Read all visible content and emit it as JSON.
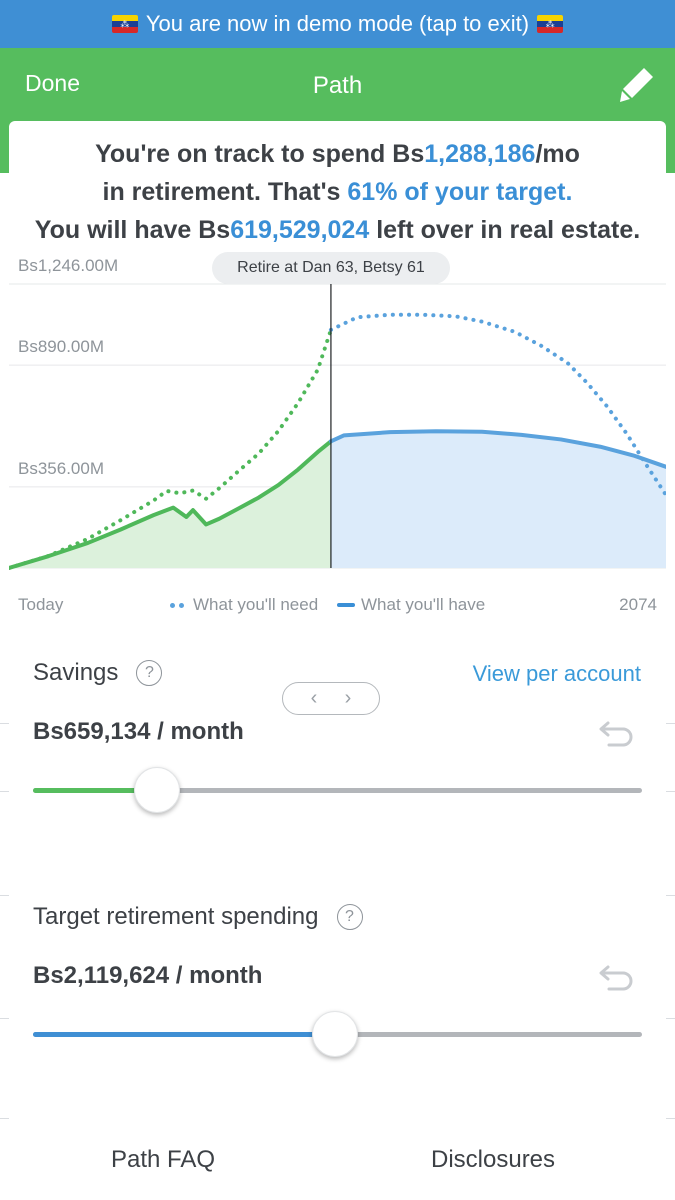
{
  "banner": {
    "text": "You are now in demo mode (tap to exit)"
  },
  "header": {
    "done_label": "Done",
    "title": "Path",
    "edit_icon": "pencil-icon"
  },
  "summary": {
    "line1_prefix": "You're on track to spend Bs",
    "line1_amount": "1,288,186",
    "line1_suffix": "/mo",
    "line2_prefix": "in retirement. That's ",
    "line2_pct": "61% of your target.",
    "line3_prefix": "You will have Bs",
    "line3_amount": "619,529,024",
    "line3_suffix": " left over in real estate."
  },
  "chart": {
    "retire_label": "Retire at Dan 63, Betsy 61",
    "start_label": "Today",
    "end_label": "2074",
    "legend_need": "What you'll need",
    "legend_have": "What you'll have",
    "colors": {
      "have_pre": "#4fb85a",
      "have_pre_fill": "#dcf1dc",
      "have_post": "#5aa2dd",
      "have_post_fill": "#dcebfa",
      "need": "#5aa2dd"
    }
  },
  "chart_data": {
    "type": "area",
    "y_tick_labels": [
      "Bs1,246.00M",
      "Bs890.00M",
      "Bs356.00M"
    ],
    "y_ticks": [
      1246,
      890,
      356
    ],
    "ylim": [
      0,
      1246
    ],
    "xlim": [
      0,
      100
    ],
    "retire_x": 49,
    "series": [
      {
        "name": "What you'll need",
        "style": "dotted",
        "x": [
          0,
          6,
          12,
          17,
          22,
          24,
          26,
          28,
          30,
          32,
          35,
          38,
          41,
          44,
          47,
          49,
          53,
          58,
          63,
          68,
          72,
          77,
          81,
          85,
          88,
          91,
          94,
          97,
          100
        ],
        "y": [
          0,
          53,
          128,
          210,
          296,
          338,
          328,
          340,
          304,
          350,
          427,
          502,
          601,
          724,
          870,
          1045,
          1100,
          1111,
          1111,
          1104,
          1081,
          1036,
          975,
          900,
          812,
          710,
          590,
          453,
          320
        ]
      },
      {
        "name": "What you'll have",
        "style": "solid",
        "x": [
          0,
          6,
          12,
          17,
          22,
          25,
          27,
          28,
          30,
          32,
          35,
          38,
          41,
          44,
          47,
          49,
          51,
          58,
          65,
          72,
          78,
          84,
          90,
          95,
          100
        ],
        "y": [
          0,
          52,
          110,
          169,
          232,
          265,
          224,
          254,
          191,
          216,
          262,
          309,
          364,
          432,
          509,
          556,
          582,
          596,
          600,
          598,
          584,
          564,
          532,
          494,
          444
        ]
      }
    ]
  },
  "savings": {
    "title": "Savings",
    "link": "View per account",
    "value": "Bs659,134 / month",
    "slider_fraction": 0.204,
    "color": "#56bd5e"
  },
  "target": {
    "title": "Target retirement spending",
    "value": "Bs2,119,624 / month",
    "slider_fraction": 0.496,
    "color": "#3f8fd4"
  },
  "footer": {
    "faq": "Path FAQ",
    "disclosures": "Disclosures"
  }
}
